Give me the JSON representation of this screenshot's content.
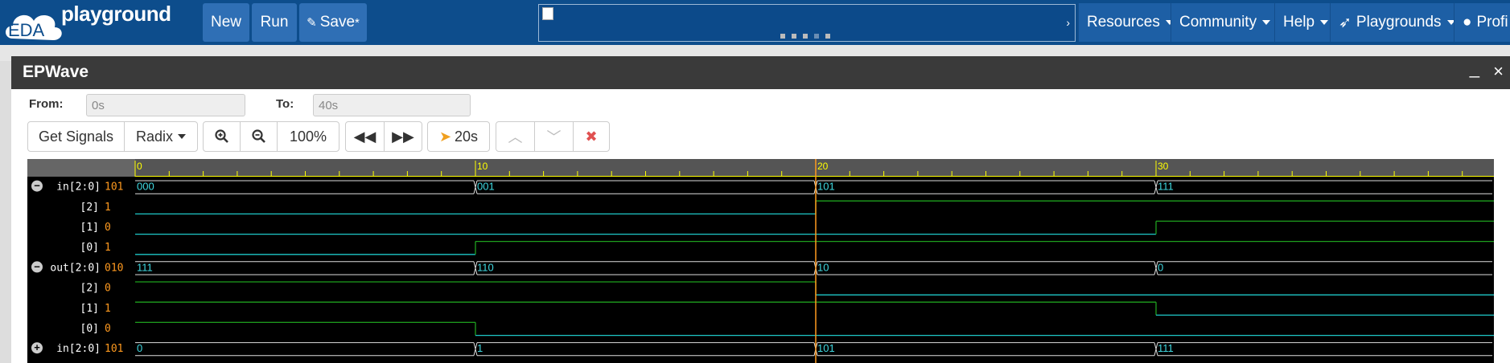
{
  "navbar": {
    "logo_text": "EDA",
    "brand": "playground",
    "new_label": "New",
    "run_label": "Run",
    "save_label": "Save",
    "save_marker": "*",
    "resources_label": "Resources",
    "community_label": "Community",
    "help_label": "Help",
    "playgrounds_label": "Playgrounds",
    "profile_label": "Profi"
  },
  "epwave": {
    "title": "EPWave",
    "minimize_glyph": "_",
    "close_glyph": "×",
    "from_label": "From:",
    "from_value": "0s",
    "to_label": "To:",
    "to_value": "40s",
    "get_signals_label": "Get Signals",
    "radix_label": "Radix",
    "zoom_level": "100%",
    "cursor_time": "20s"
  },
  "timeline": {
    "ticks": [
      "0",
      "10",
      "20",
      "30"
    ],
    "cursor_at": 20,
    "range": [
      0,
      40
    ]
  },
  "signals": [
    {
      "name": "in[2:0]",
      "value": "101",
      "type": "bus",
      "expander": "−",
      "segments": [
        {
          "t": 0,
          "v": "000"
        },
        {
          "t": 10,
          "v": "001"
        },
        {
          "t": 20,
          "v": "101"
        },
        {
          "t": 30,
          "v": "111"
        }
      ]
    },
    {
      "name": "[2]",
      "value": "1",
      "type": "bit",
      "levels": [
        {
          "t": 0,
          "v": 0
        },
        {
          "t": 20,
          "v": 1
        }
      ]
    },
    {
      "name": "[1]",
      "value": "0",
      "type": "bit",
      "levels": [
        {
          "t": 0,
          "v": 0
        },
        {
          "t": 30,
          "v": 1
        }
      ]
    },
    {
      "name": "[0]",
      "value": "1",
      "type": "bit",
      "levels": [
        {
          "t": 0,
          "v": 0
        },
        {
          "t": 10,
          "v": 1
        }
      ]
    },
    {
      "name": "out[2:0]",
      "value": "010",
      "type": "bus",
      "expander": "−",
      "segments": [
        {
          "t": 0,
          "v": "111"
        },
        {
          "t": 10,
          "v": "110"
        },
        {
          "t": 20,
          "v": "10"
        },
        {
          "t": 30,
          "v": "0"
        }
      ]
    },
    {
      "name": "[2]",
      "value": "0",
      "type": "bit",
      "levels": [
        {
          "t": 0,
          "v": 1
        },
        {
          "t": 20,
          "v": 0
        }
      ]
    },
    {
      "name": "[1]",
      "value": "1",
      "type": "bit",
      "levels": [
        {
          "t": 0,
          "v": 1
        },
        {
          "t": 30,
          "v": 0
        }
      ]
    },
    {
      "name": "[0]",
      "value": "0",
      "type": "bit",
      "levels": [
        {
          "t": 0,
          "v": 1
        },
        {
          "t": 10,
          "v": 0
        }
      ]
    },
    {
      "name": "in[2:0]",
      "value": "101",
      "type": "bus",
      "expander": "+",
      "segments": [
        {
          "t": 0,
          "v": "0"
        },
        {
          "t": 10,
          "v": "1"
        },
        {
          "t": 20,
          "v": "101"
        },
        {
          "t": 30,
          "v": "111"
        }
      ]
    }
  ],
  "colors": {
    "nav": "#0d4d8c",
    "trace_high": "#1ea01e",
    "trace_low": "#1ec8c8",
    "value": "#ff9a1f",
    "cursor": "#ff9a1f",
    "ruler": "#ffff00"
  }
}
